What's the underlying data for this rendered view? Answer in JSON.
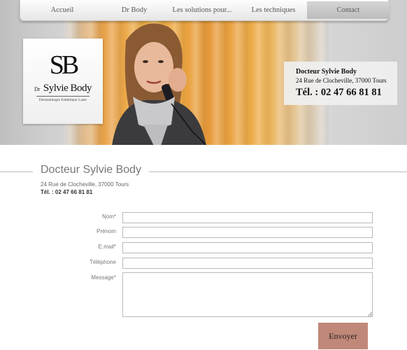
{
  "nav": {
    "items": [
      {
        "label": "Accueil"
      },
      {
        "label": "Dr Body"
      },
      {
        "label": "Les solutions pour..."
      },
      {
        "label": "Les techniques"
      },
      {
        "label": "Contact"
      }
    ],
    "active": "Contact"
  },
  "hero": {
    "logo": {
      "monogram": "SB",
      "prefix": "Dr",
      "name": "Sylvie Body",
      "tagline": "Dermatologie Esthétique Laser"
    },
    "card": {
      "name": "Docteur Sylvie Body",
      "address": "24 Rue de Clocheville, 37000 Tours",
      "phone": "Tél. : 02 47 66 81 81"
    }
  },
  "contact": {
    "title": "Docteur Sylvie Body",
    "address": "24 Rue de Clocheville, 37000 Tours",
    "phone": "Tél. : 02 47 66 81 81"
  },
  "form": {
    "fields": [
      {
        "label": "Nom*",
        "value": ""
      },
      {
        "label": "Prénom",
        "value": ""
      },
      {
        "label": "E.mail*",
        "value": ""
      },
      {
        "label": "Téléphone",
        "value": ""
      },
      {
        "label": "Message*",
        "value": ""
      }
    ],
    "submit_label": "Envoyer"
  },
  "colors": {
    "submit_bg": "#c08878",
    "nav_active_bg": "#c6c6c6",
    "title_text": "#777777"
  }
}
